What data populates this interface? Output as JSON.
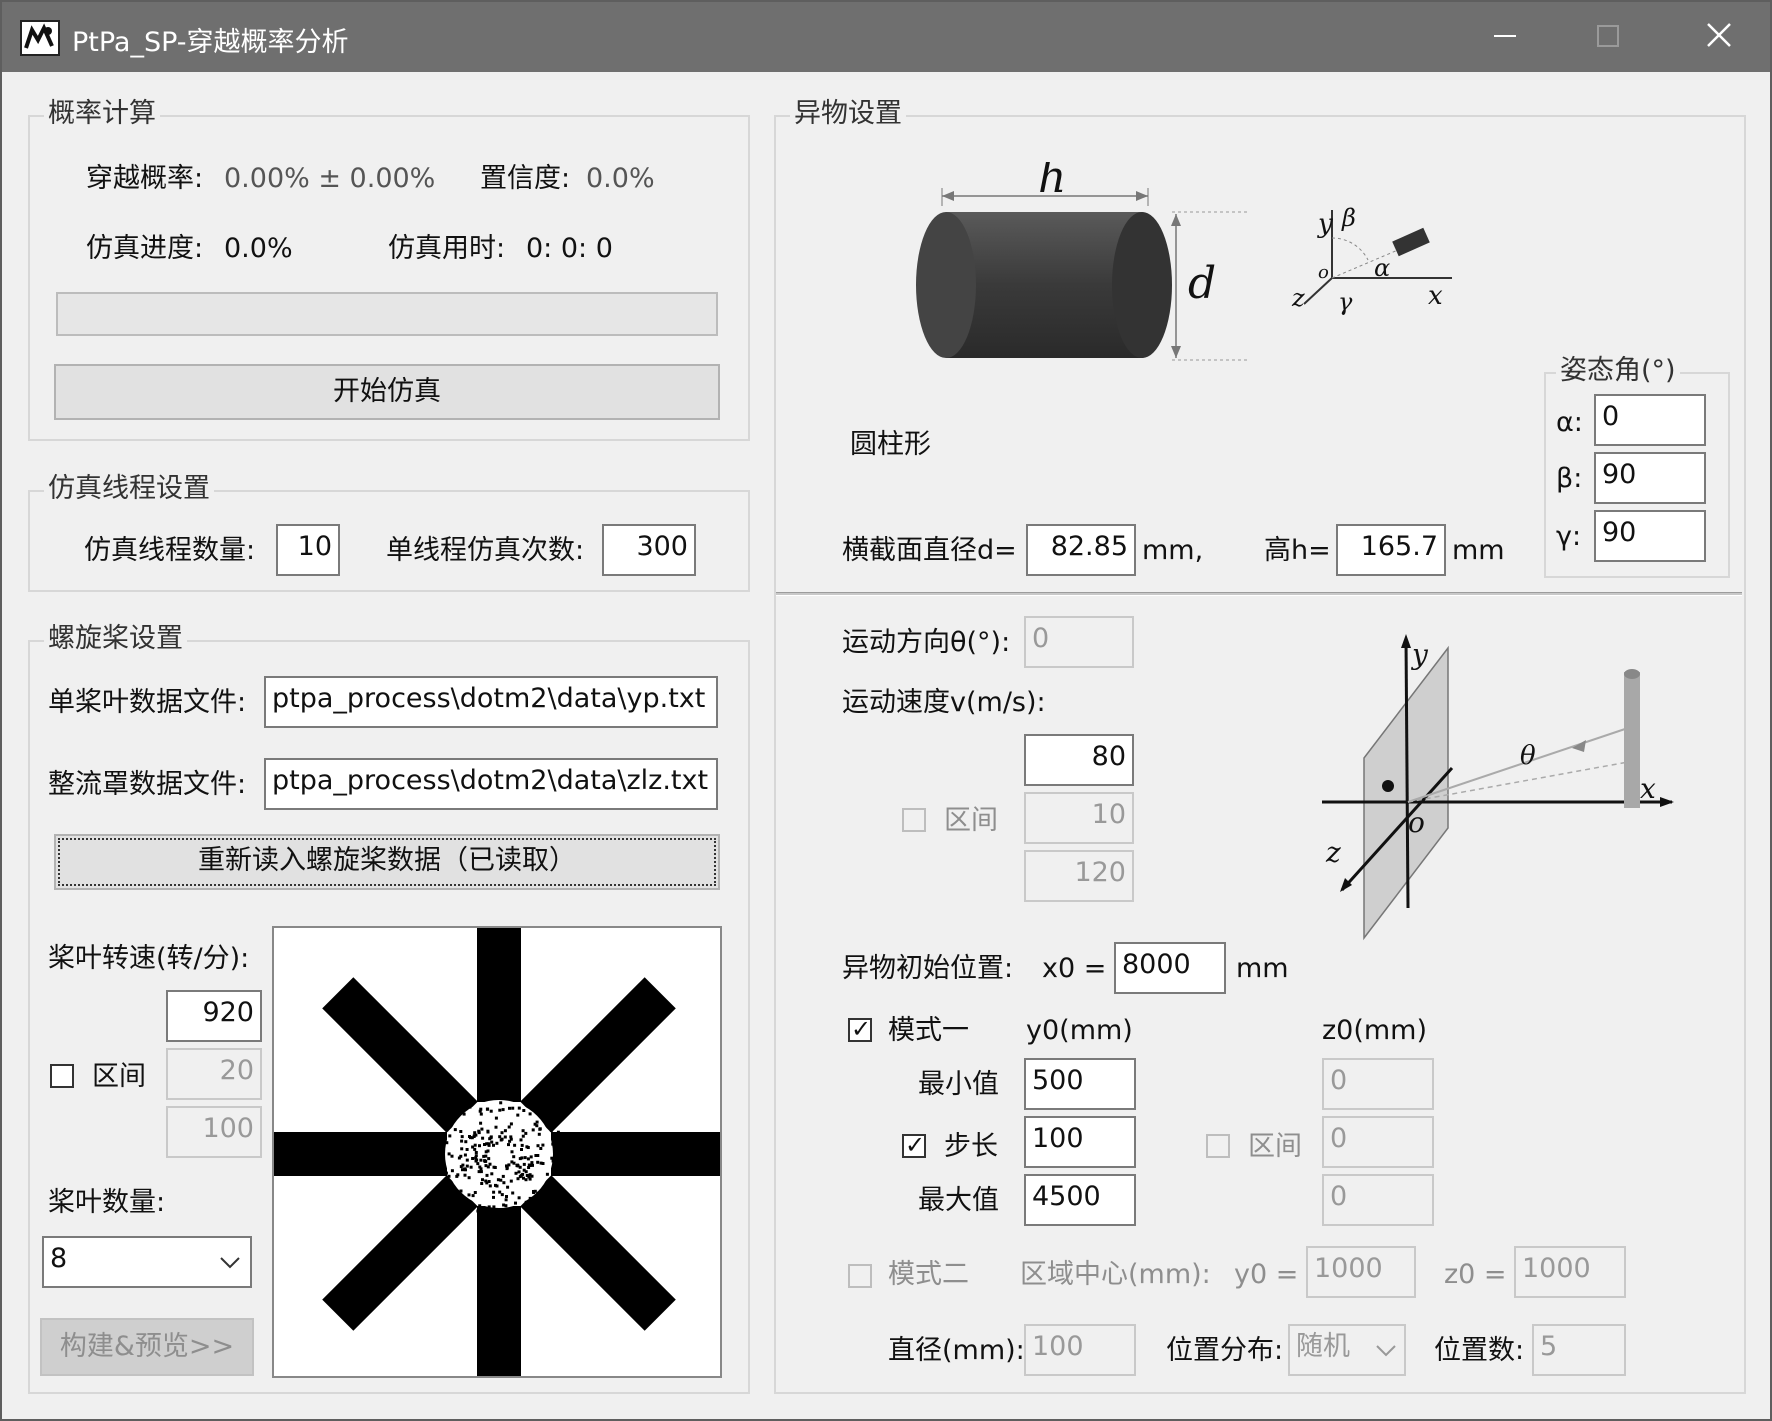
{
  "window": {
    "title": "PtPa_SP-穿越概率分析"
  },
  "probability": {
    "group_title": "概率计算",
    "cross_label": "穿越概率:",
    "cross_value": "0.00% ± 0.00%",
    "conf_label": "置信度:",
    "conf_value": "0.0%",
    "progress_label": "仿真进度:",
    "progress_value": "0.0%",
    "time_label": "仿真用时:",
    "time_value": "0: 0: 0",
    "progress_fraction": 0.0,
    "start_button": "开始仿真"
  },
  "threads": {
    "group_title": "仿真线程设置",
    "count_label": "仿真线程数量:",
    "count_value": "10",
    "runs_label": "单线程仿真次数:",
    "runs_value": "300"
  },
  "propeller": {
    "group_title": "螺旋桨设置",
    "blade_file_label": "单桨叶数据文件:",
    "blade_file_value": "ptpa_process\\dotm2\\data\\yp.txt",
    "fairing_file_label": "整流罩数据文件:",
    "fairing_file_value": "ptpa_process\\dotm2\\data\\zlz.txt",
    "reload_button": "重新读入螺旋桨数据（已读取）",
    "speed_label": "桨叶转速(转/分):",
    "speed_value": "920",
    "range_label": "区间",
    "range_step": "20",
    "range_max": "100",
    "blade_count_label": "桨叶数量:",
    "blade_count_value": "8",
    "build_button": "构建&预览>>"
  },
  "object": {
    "group_title": "异物设置",
    "diagram_h": "h",
    "diagram_d": "d",
    "axis_y": "y",
    "axis_beta": "β",
    "axis_o": "o",
    "axis_alpha": "α",
    "axis_z": "z",
    "axis_gamma": "γ",
    "axis_x": "x",
    "shape_name": "圆柱形",
    "diameter_label": "横截面直径d=",
    "diameter_value": "82.85",
    "diameter_unit": "mm,",
    "height_label": "高h=",
    "height_value": "165.7",
    "height_unit": "mm",
    "attitude": {
      "title": "姿态角(°)",
      "alpha_label": "α:",
      "alpha_value": "0",
      "beta_label": "β:",
      "beta_value": "90",
      "gamma_label": "γ:",
      "gamma_value": "90"
    }
  },
  "motion": {
    "direction_label": "运动方向θ(°):",
    "direction_value": "0",
    "speed_label": "运动速度v(m/s):",
    "speed_value": "80",
    "range_label": "区间",
    "range_step": "10",
    "range_max": "120",
    "diagram_y": "y",
    "diagram_theta": "θ",
    "diagram_x": "x",
    "diagram_o": "o",
    "diagram_z": "z",
    "init_pos_label": "异物初始位置:",
    "x0_label": "x0  =",
    "x0_value": "8000",
    "x0_unit": "mm",
    "mode1": {
      "label": "模式一",
      "y0_header": "y0(mm)",
      "z0_header": "z0(mm)",
      "min_label": "最小值",
      "min_y": "500",
      "min_z": "0",
      "step_label": "步长",
      "step_y": "100",
      "range_label": "区间",
      "step_z": "0",
      "max_label": "最大值",
      "max_y": "4500",
      "max_z": "0"
    },
    "mode2": {
      "label": "模式二",
      "center_label": "区域中心(mm):",
      "y0_label": "y0  =",
      "y0_value": "1000",
      "z0_label": "z0  =",
      "z0_value": "1000",
      "diam_label": "直径(mm):",
      "diam_value": "100",
      "dist_label": "位置分布:",
      "dist_value": "随机",
      "count_label": "位置数:",
      "count_value": "5"
    }
  },
  "icons": {
    "app": "app-icon",
    "minimize": "minimize-icon",
    "maximize": "maximize-icon",
    "close": "close-icon",
    "check": "checkmark-icon",
    "dropdown": "chevron-down-icon"
  }
}
